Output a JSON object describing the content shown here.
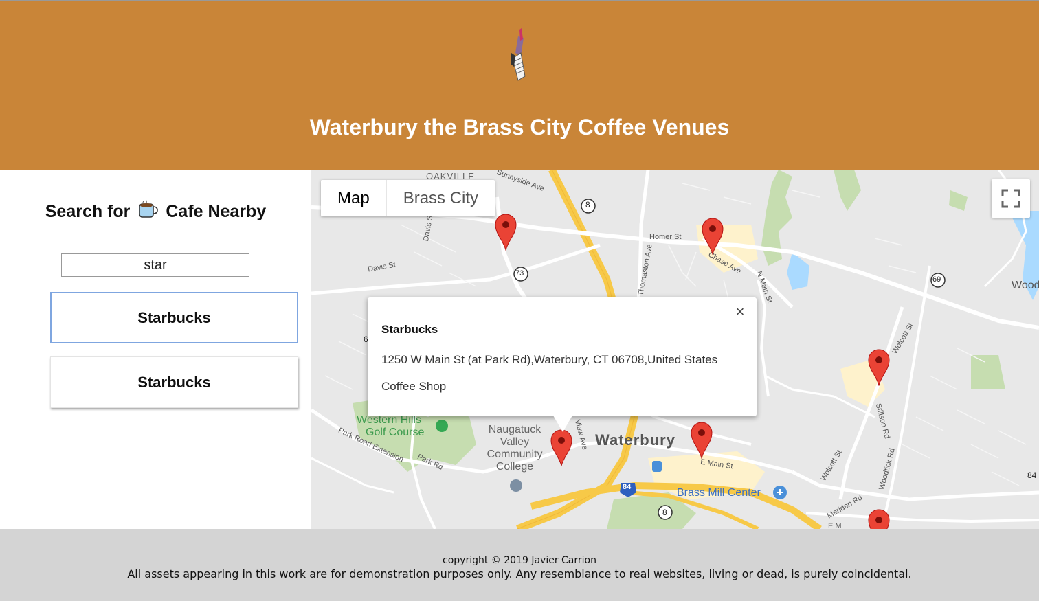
{
  "header": {
    "title": "Waterbury the Brass City Coffee Venues",
    "background_color": "#c98538",
    "logo_icon": "brass-city-logo"
  },
  "sidebar": {
    "heading_before": "Search for",
    "heading_icon": "coffee-cup-icon",
    "heading_after": "Cafe Nearby",
    "search_value": "star",
    "results": [
      {
        "label": "Starbucks",
        "active": true
      },
      {
        "label": "Starbucks",
        "active": false
      }
    ]
  },
  "map": {
    "type_buttons": [
      "Map",
      "Brass City"
    ],
    "selected_type": "Map",
    "fullscreen_icon": "fullscreen-icon",
    "marker_color": "#ea4335",
    "marker_count": 6,
    "info_window": {
      "title": "Starbucks",
      "address": "1250 W Main St (at Park Rd),Waterbury, CT 06708,United States",
      "category": "Coffee Shop",
      "close_symbol": "×"
    },
    "labels": {
      "waterbury": "Waterbury",
      "oakville": "OAKVILLE",
      "golf_course_line1": "Western Hills",
      "golf_course_line2": "Golf Course",
      "college_line1": "Naugatuck",
      "college_line2": "Valley",
      "college_line3": "Community",
      "college_line4": "College",
      "mall": "Brass Mill Center",
      "wood_partial": "Wood",
      "sunnyside": "Sunnyside Ave",
      "homer": "Homer St",
      "chase": "Chase Ave",
      "davis": "Davis St",
      "thomaston": "Thomaston Ave",
      "n_main": "N Main St",
      "wolcott": "Wolcott St",
      "wolcott_2": "Wolcott St",
      "stillson": "Stillson Rd",
      "woodtick": "Woodtick Rd",
      "meriden": "Meriden Rd",
      "park_road_ext": "Park Road Extension",
      "park_rd": "Park Rd",
      "e_main": "E Main St",
      "davis_2": "Davis St",
      "view_ave": "View Ave",
      "route_8_top": "8",
      "route_73": "73",
      "route_69": "69",
      "route_8_bottom": "8",
      "route_84": "84",
      "route_84_edge": "84",
      "route_6_edge": "6",
      "e_m_partial": "E M"
    }
  },
  "footer": {
    "copyright": "copyright © 2019 Javier Carrion",
    "disclaimer": "All assets appearing in this work are for demonstration purposes only. Any resemblance to real websites, living or dead, is purely coincidental."
  }
}
